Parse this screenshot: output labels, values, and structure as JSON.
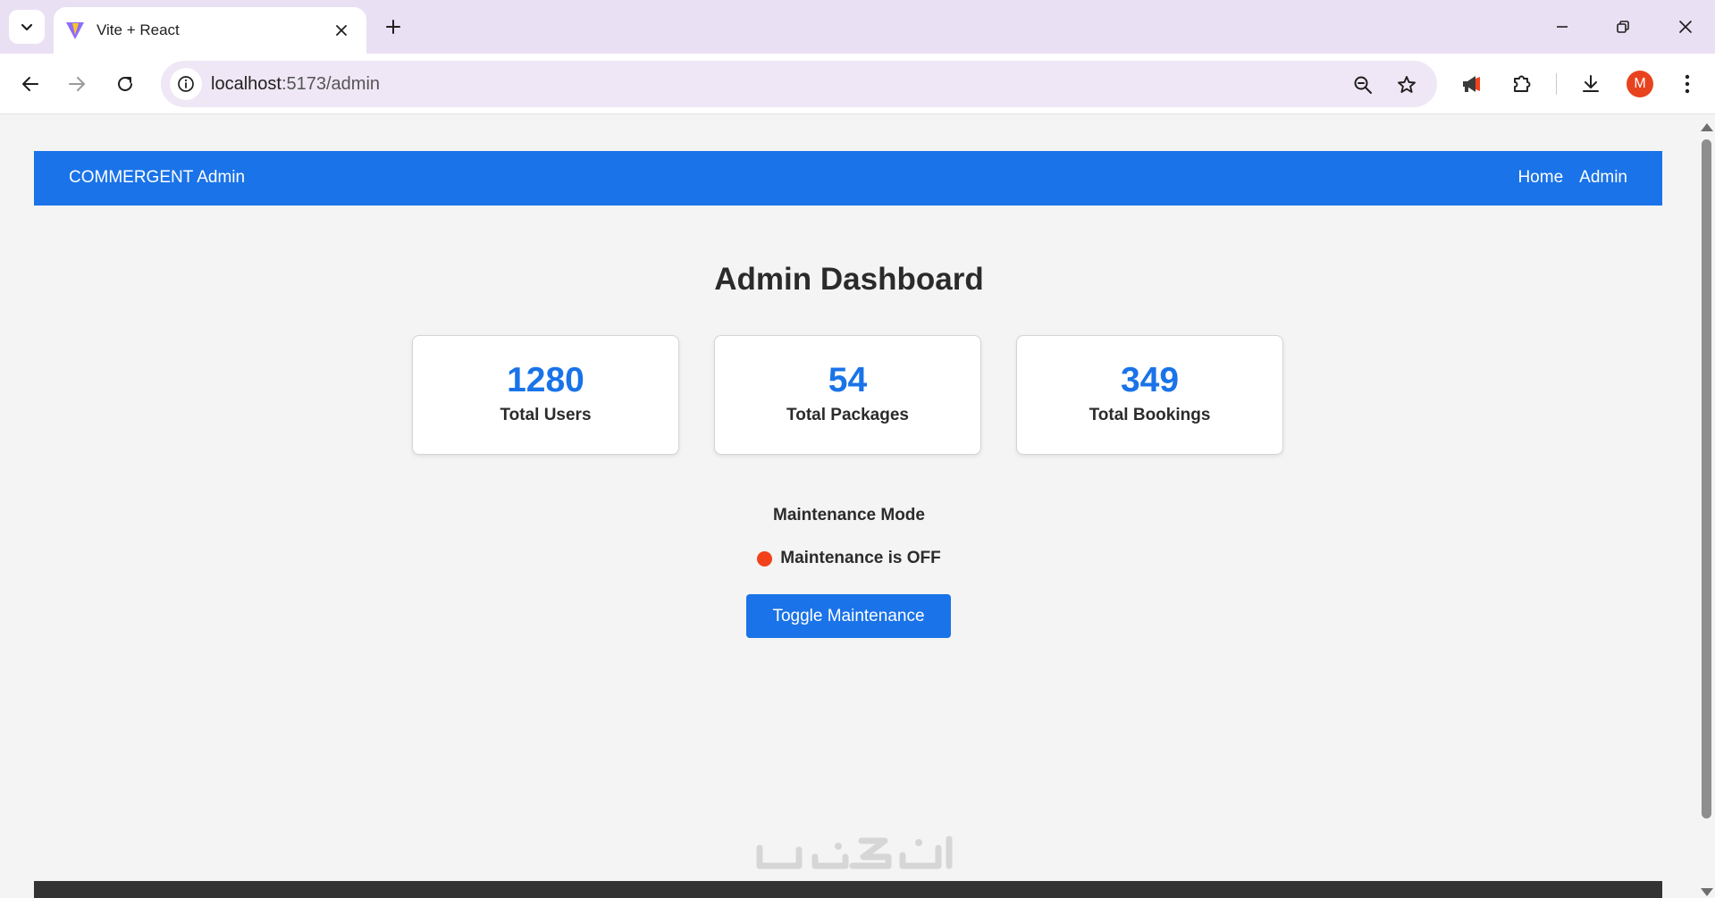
{
  "browser": {
    "tab_title": "Vite + React",
    "url_host": "localhost",
    "url_rest": ":5173/admin",
    "profile_initial": "M"
  },
  "navbar": {
    "brand": "COMMERGENT Admin",
    "links": [
      "Home",
      "Admin"
    ]
  },
  "dashboard": {
    "title": "Admin Dashboard",
    "stats": [
      {
        "value": "1280",
        "label": "Total Users"
      },
      {
        "value": "54",
        "label": "Total Packages"
      },
      {
        "value": "349",
        "label": "Total Bookings"
      }
    ]
  },
  "maintenance": {
    "heading": "Maintenance Mode",
    "status": "Maintenance is OFF",
    "status_color": "#f2421b",
    "toggle_label": "Toggle Maintenance"
  },
  "colors": {
    "accent": "#1a73e8",
    "footer": "#333333"
  }
}
